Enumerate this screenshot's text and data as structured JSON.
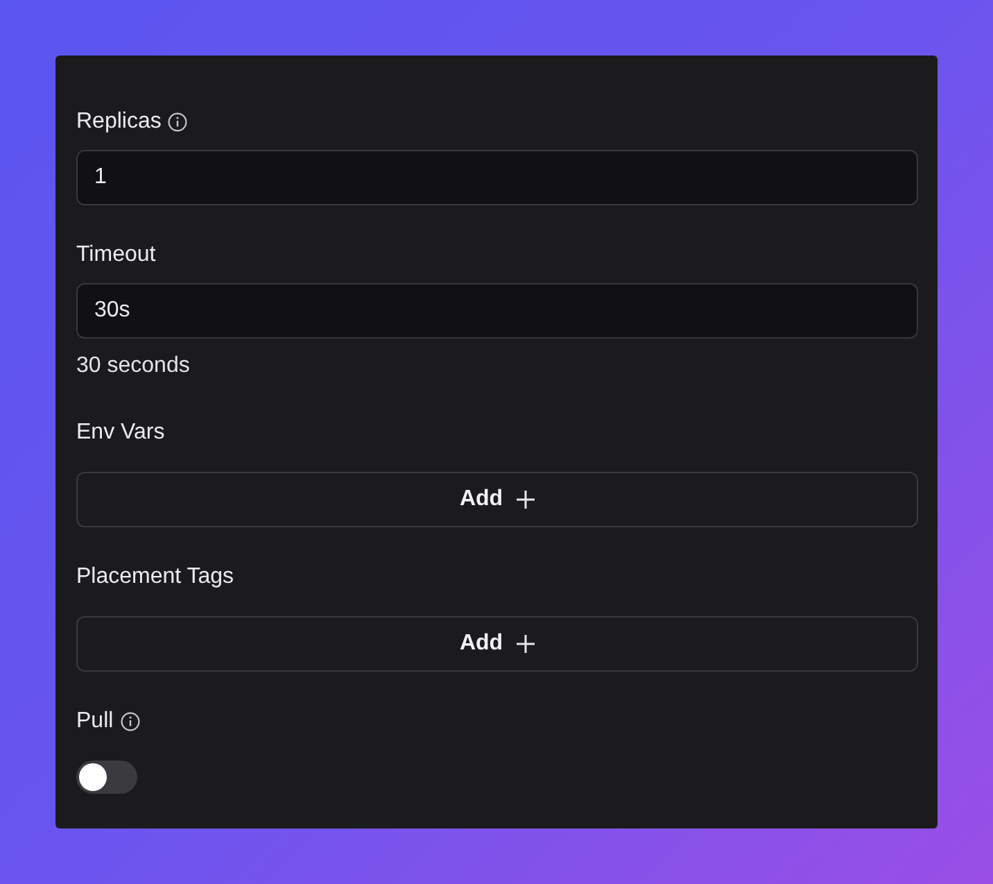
{
  "fields": [
    {
      "kind": "input",
      "label": "Replicas",
      "info": true,
      "value": "1"
    },
    {
      "kind": "input",
      "label": "Timeout",
      "info": false,
      "value": "30s",
      "hint": "30 seconds"
    },
    {
      "kind": "add",
      "label": "Env Vars",
      "info": false,
      "button": "Add"
    },
    {
      "kind": "add",
      "label": "Placement Tags",
      "info": false,
      "button": "Add"
    },
    {
      "kind": "toggle",
      "label": "Pull",
      "info": true,
      "on": false
    }
  ]
}
